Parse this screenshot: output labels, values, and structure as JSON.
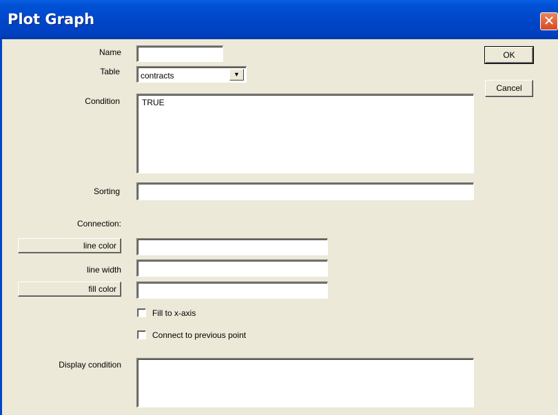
{
  "window": {
    "title": "Plot Graph",
    "close_glyph": "✕"
  },
  "form": {
    "name_label": "Name",
    "name_value": "",
    "table_label": "Table",
    "table_value": "contracts",
    "condition_label": "Condition",
    "condition_value": "TRUE",
    "sorting_label": "Sorting",
    "sorting_value": "",
    "connection_label": "Connection:",
    "line_color_label": "line color",
    "line_color_value": "",
    "line_width_label": "line width",
    "line_width_value": "",
    "fill_color_label": "fill color",
    "fill_color_value": "",
    "fill_to_x_axis_label": "Fill to x-axis",
    "connect_previous_label": "Connect to previous point",
    "display_condition_label": "Display condition",
    "display_condition_value": ""
  },
  "buttons": {
    "ok_label": "OK",
    "cancel_label": "Cancel"
  },
  "icons": {
    "dropdown_arrow": "▼"
  },
  "colors": {
    "titlebar": "#0046c9",
    "dialog_bg": "#ece9d8",
    "close_button": "#d8491f"
  }
}
